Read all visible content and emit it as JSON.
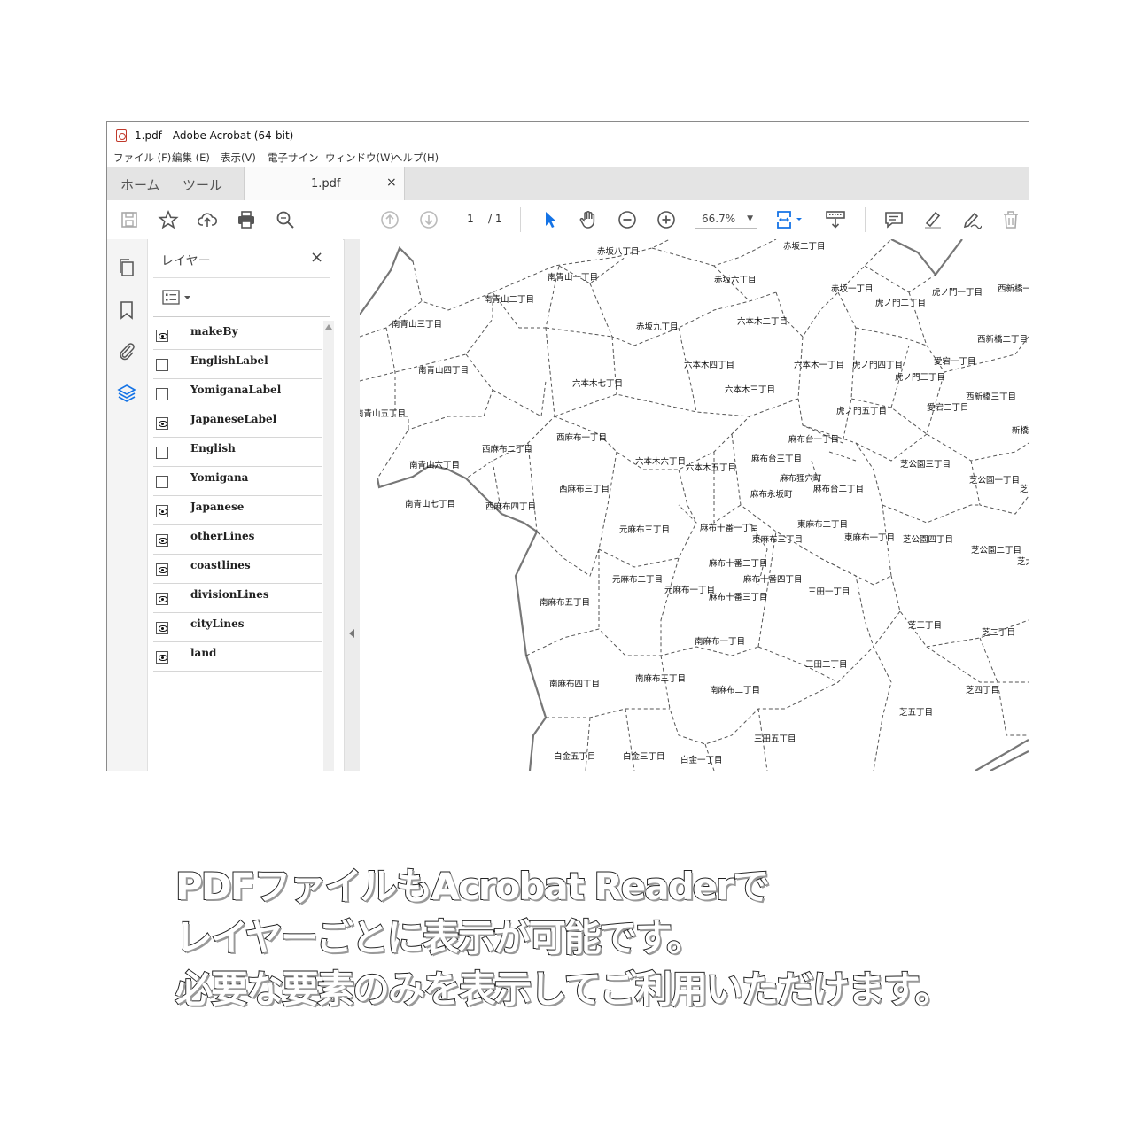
{
  "window": {
    "title": "1.pdf - Adobe Acrobat (64-bit)"
  },
  "menu": [
    "ファイル (F)",
    "編集 (E)",
    "表示(V)",
    "電子サイン",
    "ウィンドウ(W)",
    "ヘルプ(H)"
  ],
  "tabs": {
    "home": "ホーム",
    "tools": "ツール",
    "document": "1.pdf",
    "close": "×"
  },
  "toolbar": {
    "page_current": "1",
    "page_total": "/ 1",
    "zoom": "66.7%"
  },
  "layers_panel": {
    "title": "レイヤー",
    "close": "×",
    "layers": [
      {
        "name": "makeBy",
        "visible": true
      },
      {
        "name": "EnglishLabel",
        "visible": false
      },
      {
        "name": "YomiganaLabel",
        "visible": false
      },
      {
        "name": "JapaneseLabel",
        "visible": true
      },
      {
        "name": "English",
        "visible": false
      },
      {
        "name": "Yomigana",
        "visible": false
      },
      {
        "name": "Japanese",
        "visible": true
      },
      {
        "name": "otherLines",
        "visible": true
      },
      {
        "name": "coastlines",
        "visible": true
      },
      {
        "name": "divisionLines",
        "visible": true
      },
      {
        "name": "cityLines",
        "visible": true
      },
      {
        "name": "land",
        "visible": true
      }
    ]
  },
  "map_labels": [
    "赤坂八丁目",
    "赤坂二丁目",
    "南青山一丁目",
    "赤坂六丁目",
    "赤坂一丁目",
    "虎ノ門一丁目",
    "西新橋一",
    "南青山二丁目",
    "六本木二丁目",
    "虎ノ門二丁目",
    "南青山三丁目",
    "赤坂九丁目",
    "西新橋二丁目",
    "南青山四丁目",
    "六本木四丁目",
    "六本木一丁目",
    "虎ノ門四丁目",
    "愛宕一丁目",
    "六本木七丁目",
    "六本木三丁目",
    "虎ノ門三丁目",
    "西新橋三丁目",
    "南青山五丁目",
    "愛宕二丁目",
    "虎ノ門五丁目",
    "西麻布一丁目",
    "麻布台一丁目",
    "新橋",
    "西麻布二丁目",
    "六本木六丁目",
    "麻布台三丁目",
    "南青山六丁目",
    "六本木五丁目",
    "芝公園三丁目",
    "麻布狸穴町",
    "芝公園一丁目",
    "麻布台二丁目",
    "芝大門",
    "西麻布三丁目",
    "麻布永坂町",
    "南青山七丁目",
    "西麻布四丁目",
    "東麻布二丁目",
    "元麻布三丁目",
    "麻布十番一丁目",
    "東麻布三丁目",
    "東麻布一丁目",
    "芝公園四丁目",
    "芝公園二丁目",
    "芝大門",
    "麻布十番二丁目",
    "元麻布二丁目",
    "麻布十番四丁目",
    "元麻布一丁目",
    "三田一丁目",
    "麻布十番三丁目",
    "南麻布五丁目",
    "芝三丁目",
    "芝二丁目",
    "南麻布一丁目",
    "三田二丁目",
    "南麻布三丁目",
    "南麻布四丁目",
    "南麻布二丁目",
    "芝四丁目",
    "芝五丁目",
    "三田五丁目",
    "白金五丁目",
    "白金三丁目",
    "白金一丁目"
  ],
  "caption": [
    "PDFファイルもAcrobat Readerで",
    "レイヤーごとに表示が可能です。",
    "必要な要素のみを表示してご利用いただけます。"
  ]
}
